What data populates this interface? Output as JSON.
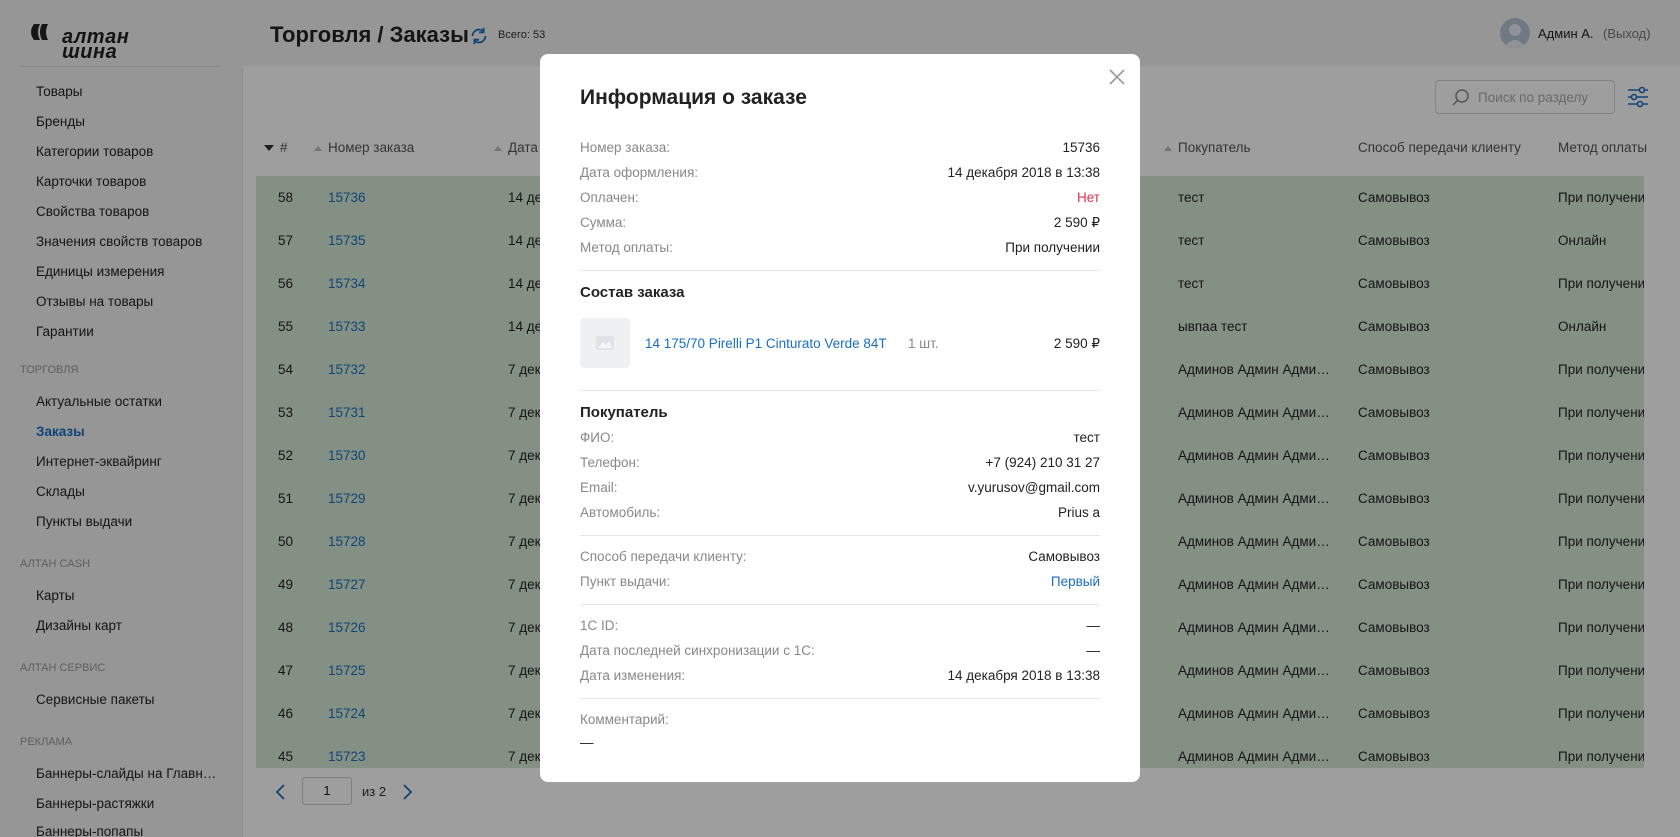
{
  "header": {
    "logo_text_line1": "алтан",
    "logo_text_line2": "шина",
    "title": "Торговля / Заказы",
    "total": "Всего: 53",
    "user_name": "Админ А.",
    "logout": "(Выход)"
  },
  "sidebar": {
    "group1": [
      "Товары",
      "Бренды",
      "Категории товаров",
      "Карточки товаров",
      "Свойства товаров",
      "Значения свойств товаров",
      "Единицы измерения",
      "Отзывы на товары",
      "Гарантии"
    ],
    "section_trade": "Торговля",
    "group2": [
      "Актуальные остатки",
      "Заказы",
      "Интернет-эквайринг",
      "Склады",
      "Пункты выдачи"
    ],
    "active_item": "Заказы",
    "section_cash": "Алтан Cash",
    "group3": [
      "Карты",
      "Дизайны карт"
    ],
    "section_service": "Алтан Сервис",
    "group4": [
      "Сервисные пакеты"
    ],
    "section_ads": "Реклама",
    "group5": [
      "Баннеры-слайды на Главн…",
      "Баннеры-растяжки",
      "Баннеры-попапы"
    ]
  },
  "search": {
    "placeholder": "Поиск по разделу"
  },
  "table": {
    "headers": {
      "num": "#",
      "order_number": "Номер заказа",
      "date": "Дата",
      "buyer": "Покупатель",
      "delivery": "Способ передачи клиенту",
      "payment": "Метод оплаты"
    },
    "rows": [
      {
        "num": "58",
        "order": "15736",
        "date": "14 де",
        "buyer": "тест",
        "delivery": "Самовывоз",
        "payment": "При получени"
      },
      {
        "num": "57",
        "order": "15735",
        "date": "14 де",
        "buyer": "тест",
        "delivery": "Самовывоз",
        "payment": "Онлайн"
      },
      {
        "num": "56",
        "order": "15734",
        "date": "14 де",
        "buyer": "тест",
        "delivery": "Самовывоз",
        "payment": "При получени"
      },
      {
        "num": "55",
        "order": "15733",
        "date": "14 де",
        "buyer": "ывпаа тест",
        "delivery": "Самовывоз",
        "payment": "Онлайн"
      },
      {
        "num": "54",
        "order": "15732",
        "date": "7 дек",
        "buyer": "Админов Админ Адми…",
        "delivery": "Самовывоз",
        "payment": "При получени"
      },
      {
        "num": "53",
        "order": "15731",
        "date": "7 дек",
        "buyer": "Админов Админ Адми…",
        "delivery": "Самовывоз",
        "payment": "При получени"
      },
      {
        "num": "52",
        "order": "15730",
        "date": "7 дек",
        "buyer": "Админов Админ Адми…",
        "delivery": "Самовывоз",
        "payment": "При получени"
      },
      {
        "num": "51",
        "order": "15729",
        "date": "7 дек",
        "buyer": "Админов Админ Адми…",
        "delivery": "Самовывоз",
        "payment": "При получени"
      },
      {
        "num": "50",
        "order": "15728",
        "date": "7 дек",
        "buyer": "Админов Админ Адми…",
        "delivery": "Самовывоз",
        "payment": "При получени"
      },
      {
        "num": "49",
        "order": "15727",
        "date": "7 дек",
        "buyer": "Админов Админ Адми…",
        "delivery": "Самовывоз",
        "payment": "При получени"
      },
      {
        "num": "48",
        "order": "15726",
        "date": "7 дек",
        "buyer": "Админов Админ Адми…",
        "delivery": "Самовывоз",
        "payment": "При получени"
      },
      {
        "num": "47",
        "order": "15725",
        "date": "7 дек",
        "buyer": "Админов Админ Адми…",
        "delivery": "Самовывоз",
        "payment": "При получени"
      },
      {
        "num": "46",
        "order": "15724",
        "date": "7 дек",
        "buyer": "Админов Админ Адми…",
        "delivery": "Самовывоз",
        "payment": "При получени"
      },
      {
        "num": "45",
        "order": "15723",
        "date": "7 дек",
        "buyer": "Админов Админ Адми…",
        "delivery": "Самовывоз",
        "payment": "При получени"
      }
    ]
  },
  "pager": {
    "page": "1",
    "of": "из 2"
  },
  "modal": {
    "title": "Информация о заказе",
    "order_number_label": "Номер заказа:",
    "order_number": "15736",
    "date_label": "Дата оформления:",
    "date": "14 декабря 2018 в 13:38",
    "paid_label": "Оплачен:",
    "paid": "Нет",
    "sum_label": "Сумма:",
    "sum": "2 590 ₽",
    "payment_label": "Метод оплаты:",
    "payment": "При получении",
    "composition_title": "Состав заказа",
    "product": {
      "name": "14 175/70 Pirelli P1 Cinturato Verde 84T",
      "qty": "1  шт.",
      "price": "2 590  ₽"
    },
    "buyer_title": "Покупатель",
    "fio_label": "ФИО:",
    "fio": "тест",
    "phone_label": "Телефон:",
    "phone": "+7 (924) 210 31 27",
    "email_label": "Email:",
    "email": "v.yurusov@gmail.com",
    "car_label": "Автомобиль:",
    "car": "Prius a",
    "delivery_label": "Способ передачи клиенту:",
    "delivery": "Самовывоз",
    "pickup_label": "Пункт выдачи:",
    "pickup": "Первый",
    "id1c_label": "1С ID:",
    "id1c": "—",
    "sync_label": "Дата последней синхронизации с 1С:",
    "sync": "—",
    "changed_label": "Дата изменения:",
    "changed": "14 декабря 2018 в 13:38",
    "comment_label": "Комментарий:",
    "comment": "—"
  },
  "colors": {
    "accent": "#1a6fc2",
    "row_bg": "#d6e8d5",
    "danger": "#e0304e"
  }
}
